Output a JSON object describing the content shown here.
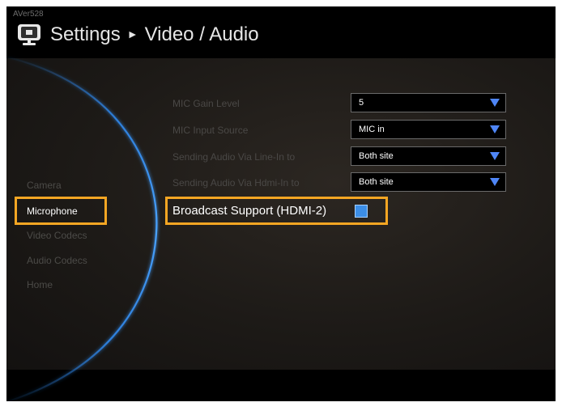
{
  "brand": "AVer528",
  "header": {
    "section": "Settings",
    "arrow": "►",
    "page": "Video / Audio"
  },
  "sidebar": {
    "items": [
      {
        "label": "Camera",
        "active": false
      },
      {
        "label": "Microphone",
        "active": true
      },
      {
        "label": "Video Codecs",
        "active": false
      },
      {
        "label": "Audio Codecs",
        "active": false
      },
      {
        "label": "Home",
        "active": false
      }
    ]
  },
  "settings": [
    {
      "label": "MIC Gain Level",
      "value": "5"
    },
    {
      "label": "MIC Input Source",
      "value": "MIC in"
    },
    {
      "label": "Sending Audio Via Line-In to",
      "value": "Both site"
    },
    {
      "label": "Sending Audio Via Hdmi-In to",
      "value": "Both site"
    }
  ],
  "broadcast": {
    "label": "Broadcast Support (HDMI-2)",
    "checked": true
  },
  "colors": {
    "highlight": "#f5a623",
    "checkbox": "#3c8ee6",
    "dropdown_arrow": "#4f86f7",
    "arc": "#2f86e8"
  },
  "icons": {
    "title": "monitor-icon",
    "dropdown": "triangle-down-icon"
  }
}
